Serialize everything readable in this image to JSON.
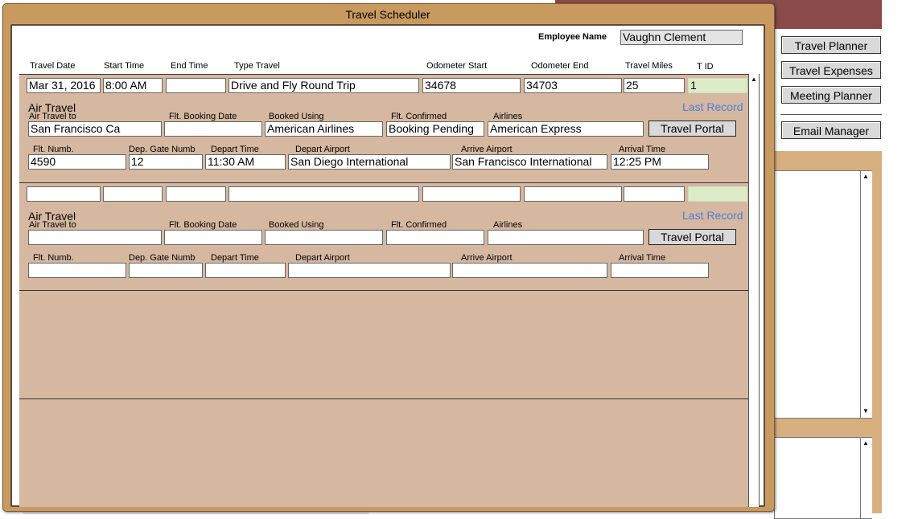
{
  "dialog": {
    "title": "Travel Scheduler"
  },
  "employee": {
    "label": "Employee Name",
    "value": "Vaughn Clement"
  },
  "columns": {
    "travel_date": "Travel Date",
    "start_time": "Start Time",
    "end_time": "End Time",
    "type_travel": "Type Travel",
    "odometer_start": "Odometer Start",
    "odometer_end": "Odometer End",
    "travel_miles": "Travel Miles",
    "t_id": "T ID"
  },
  "labels": {
    "air_travel": "Air Travel",
    "air_travel_to": "Air Travel to",
    "flt_booking_date": "Flt. Booking Date",
    "booked_using": "Booked Using",
    "flt_confirmed": "Flt. Confirmed",
    "airlines": "Airlines",
    "travel_portal": "Travel Portal",
    "last_record": "Last Record",
    "flt_numb": "Flt. Numb.",
    "dep_gate_numb": "Dep. Gate Numb",
    "depart_time": "Depart Time",
    "depart_airport": "Depart Airport",
    "arrive_airport": "Arrive Airport",
    "arrival_time": "Arrival Time"
  },
  "records": [
    {
      "travel_date": "Mar 31, 2016",
      "start_time": "8:00 AM",
      "end_time": "",
      "type_travel": "Drive and Fly Round Trip",
      "odometer_start": "34678",
      "odometer_end": "34703",
      "travel_miles": "25",
      "t_id": "1",
      "air_travel_to": "San Francisco Ca",
      "flt_booking_date": "",
      "booked_using": "American Airlines",
      "flt_confirmed": "Booking Pending",
      "airlines": "American Express",
      "flt_numb": "4590",
      "dep_gate_numb": "12",
      "depart_time": "11:30 AM",
      "depart_airport": "San Diego International",
      "arrive_airport": "San Francisco International",
      "arrival_time": "12:25 PM"
    },
    {
      "travel_date": "",
      "start_time": "",
      "end_time": "",
      "type_travel": "",
      "odometer_start": "",
      "odometer_end": "",
      "travel_miles": "",
      "t_id": "",
      "air_travel_to": "",
      "flt_booking_date": "",
      "booked_using": "",
      "flt_confirmed": "",
      "airlines": "",
      "flt_numb": "",
      "dep_gate_numb": "",
      "depart_time": "",
      "depart_airport": "",
      "arrive_airport": "",
      "arrival_time": ""
    }
  ],
  "sidebar": {
    "buttons": [
      "Travel Planner",
      "Travel Expenses",
      "Meeting Planner",
      "Email Manager"
    ]
  },
  "colors": {
    "dialog_bg": "#c99a5f",
    "portal_bg": "#d6b8a0",
    "link": "#4a7fd8",
    "t_id_bg": "#dcebc8",
    "header_bar": "#8a4a4a"
  }
}
